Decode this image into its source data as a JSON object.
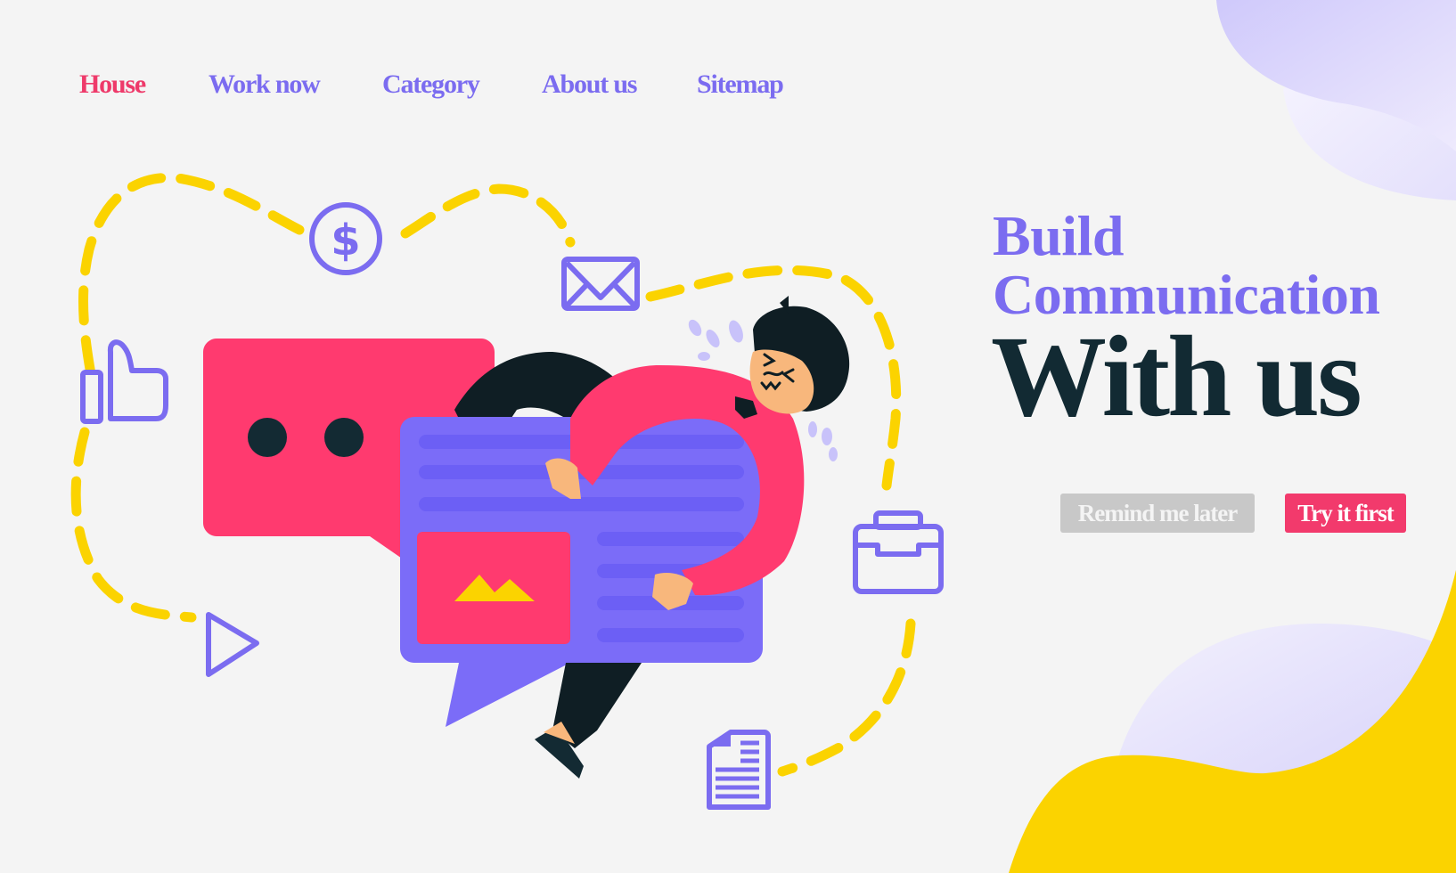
{
  "nav": {
    "items": [
      {
        "label": "House",
        "active": true
      },
      {
        "label": "Work now",
        "active": false
      },
      {
        "label": "Category",
        "active": false
      },
      {
        "label": "About us",
        "active": false
      },
      {
        "label": "Sitemap",
        "active": false
      }
    ]
  },
  "hero": {
    "line1": "Build",
    "line2": "Communication",
    "line3": "With us"
  },
  "buttons": {
    "remind_label": "Remind me later",
    "try_label": "Try it first"
  },
  "illustration": {
    "icons": [
      "dollar-coin-icon",
      "envelope-icon",
      "thumbs-up-icon",
      "play-icon",
      "briefcase-icon",
      "document-icon",
      "image-icon"
    ],
    "description": "Stressed man hugging a purple chat bubble in front of a pink chat bubble with typing dots"
  },
  "colors": {
    "background": "#f4f4f4",
    "accent_purple": "#7b6cf0",
    "accent_pink": "#f23a6c",
    "accent_yellow": "#fbd300",
    "heading_dark": "#122a33",
    "button_gray": "#c8c8c8"
  }
}
